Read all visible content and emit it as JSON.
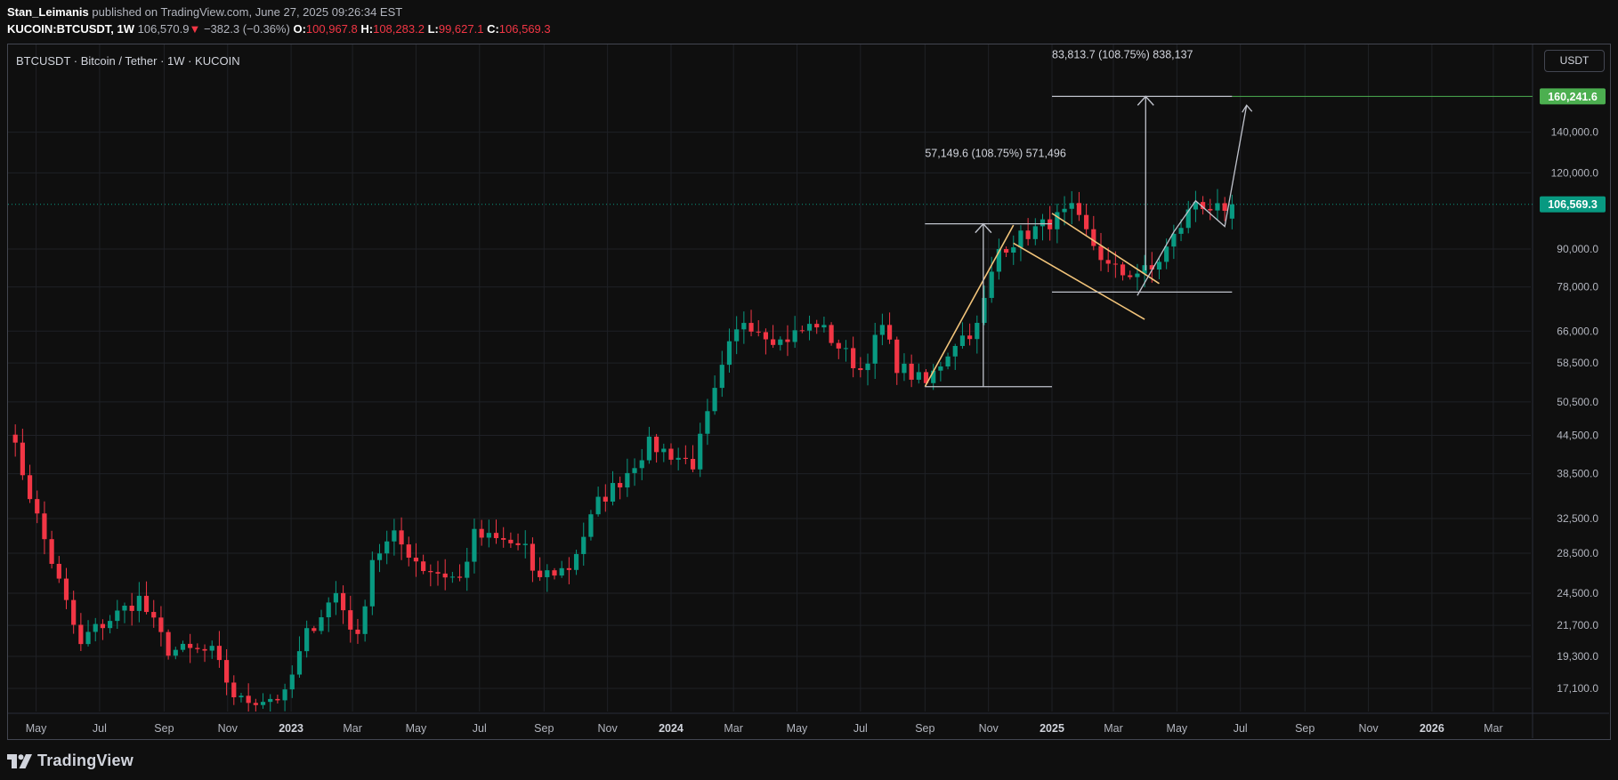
{
  "header": {
    "author": "Stan_Leimanis",
    "published": " published on TradingView.com, June 27, 2025 09:26:34 EST",
    "symbol": "KUCOIN:BTCUSDT, 1W",
    "last_price": "106,570.9",
    "change": "−382.3 (−0.36%)",
    "o_label": "O:",
    "o_value": "100,967.8",
    "h_label": "H:",
    "h_value": "108,283.2",
    "l_label": "L:",
    "l_value": "99,627.1",
    "c_label": "C:",
    "c_value": "106,569.3"
  },
  "legend": "BTCUSDT · Bitcoin / Tether · 1W · KUCOIN",
  "currency_button": "USDT",
  "footer": {
    "brand": "TradingView"
  },
  "colors": {
    "up": "#089981",
    "down": "#f23645",
    "pattern": "#f2c47a",
    "measure": "#c0c3cc",
    "target": "#4caf50",
    "background": "#0f0f0f"
  },
  "chart_data": {
    "type": "candlestick",
    "y_scale": "log",
    "ylim": [
      15000,
      200000
    ],
    "x_range": [
      "2022-04-04",
      "2026-04-06"
    ],
    "y_ticks": [
      17100,
      19300,
      21700,
      24500,
      28500,
      32500,
      38500,
      44500,
      50500,
      58500,
      66000,
      78000,
      90000,
      120000,
      140000
    ],
    "y_tick_labels": [
      "17,100.0",
      "19,300.0",
      "21,700.0",
      "24,500.0",
      "28,500.0",
      "32,500.0",
      "38,500.0",
      "44,500.0",
      "50,500.0",
      "58,500.0",
      "66,000.0",
      "78,000.0",
      "90,000.0",
      "120,000.0",
      "140,000.0"
    ],
    "x_ticks": [
      {
        "date": "2022-05-01",
        "label": "May"
      },
      {
        "date": "2022-07-01",
        "label": "Jul"
      },
      {
        "date": "2022-09-01",
        "label": "Sep"
      },
      {
        "date": "2022-11-01",
        "label": "Nov"
      },
      {
        "date": "2023-01-01",
        "label": "2023"
      },
      {
        "date": "2023-03-01",
        "label": "Mar"
      },
      {
        "date": "2023-05-01",
        "label": "May"
      },
      {
        "date": "2023-07-01",
        "label": "Jul"
      },
      {
        "date": "2023-09-01",
        "label": "Sep"
      },
      {
        "date": "2023-11-01",
        "label": "Nov"
      },
      {
        "date": "2024-01-01",
        "label": "2024"
      },
      {
        "date": "2024-03-01",
        "label": "Mar"
      },
      {
        "date": "2024-05-01",
        "label": "May"
      },
      {
        "date": "2024-07-01",
        "label": "Jul"
      },
      {
        "date": "2024-09-01",
        "label": "Sep"
      },
      {
        "date": "2024-11-01",
        "label": "Nov"
      },
      {
        "date": "2025-01-01",
        "label": "2025"
      },
      {
        "date": "2025-03-01",
        "label": "Mar"
      },
      {
        "date": "2025-05-01",
        "label": "May"
      },
      {
        "date": "2025-07-01",
        "label": "Jul"
      },
      {
        "date": "2025-09-01",
        "label": "Sep"
      },
      {
        "date": "2025-11-01",
        "label": "Nov"
      },
      {
        "date": "2026-01-01",
        "label": "2026"
      },
      {
        "date": "2026-03-01",
        "label": "Mar"
      }
    ],
    "bold_x_labels": [
      "2023",
      "2024",
      "2025",
      "2026"
    ],
    "current_price": {
      "value": 106569.3,
      "label": "106,569.3"
    },
    "target_price": {
      "value": 160241.6,
      "label": "160,241.6"
    },
    "measure_labels": [
      {
        "text": "57,149.6 (108.75%) 571,496",
        "date": "2024-09-01",
        "value": 127500
      },
      {
        "text": "83,813.7 (108.75%) 838,137",
        "date": "2025-01-01",
        "value": 185000
      }
    ],
    "pivots": [
      [
        "2022-04-04",
        46000
      ],
      [
        "2022-05-09",
        30000
      ],
      [
        "2022-06-13",
        20000
      ],
      [
        "2022-06-20",
        21000
      ],
      [
        "2022-08-08",
        24000
      ],
      [
        "2022-09-05",
        19800
      ],
      [
        "2022-10-17",
        19600
      ],
      [
        "2022-11-07",
        16700
      ],
      [
        "2022-11-14",
        16300
      ],
      [
        "2022-12-26",
        16600
      ],
      [
        "2023-01-16",
        21000
      ],
      [
        "2023-02-13",
        24500
      ],
      [
        "2023-03-06",
        20500
      ],
      [
        "2023-03-20",
        28000
      ],
      [
        "2023-04-10",
        30300
      ],
      [
        "2023-05-08",
        27000
      ],
      [
        "2023-06-12",
        25800
      ],
      [
        "2023-06-26",
        30500
      ],
      [
        "2023-08-14",
        29200
      ],
      [
        "2023-08-21",
        26000
      ],
      [
        "2023-09-25",
        27000
      ],
      [
        "2023-10-23",
        34500
      ],
      [
        "2023-11-13",
        37500
      ],
      [
        "2023-12-11",
        43000
      ],
      [
        "2024-01-22",
        40000
      ],
      [
        "2024-02-26",
        62000
      ],
      [
        "2024-03-11",
        69000
      ],
      [
        "2024-04-15",
        63500
      ],
      [
        "2024-05-20",
        68000
      ],
      [
        "2024-07-01",
        57000
      ],
      [
        "2024-07-22",
        67000
      ],
      [
        "2024-08-05",
        58000
      ],
      [
        "2024-09-02",
        54000
      ],
      [
        "2024-09-30",
        63500
      ],
      [
        "2024-10-21",
        67000
      ],
      [
        "2024-11-11",
        90000
      ],
      [
        "2024-12-16",
        97000
      ],
      [
        "2025-01-20",
        104000
      ],
      [
        "2025-02-24",
        84000
      ],
      [
        "2025-03-10",
        82000
      ],
      [
        "2025-04-07",
        83000
      ],
      [
        "2025-04-28",
        94000
      ],
      [
        "2025-05-19",
        108000
      ],
      [
        "2025-06-09",
        104000
      ],
      [
        "2025-06-16",
        101000
      ],
      [
        "2025-06-23",
        106569
      ]
    ],
    "overlays": {
      "pattern_lines": [
        [
          [
            "2024-09-01",
            53500
          ],
          [
            "2024-11-25",
            98500
          ]
        ],
        [
          [
            "2024-11-25",
            92000
          ],
          [
            "2025-03-31",
            69000
          ]
        ],
        [
          [
            "2025-01-01",
            103000
          ],
          [
            "2025-04-14",
            79000
          ]
        ]
      ],
      "measure_lines": [
        [
          [
            "2024-09-01",
            53500
          ],
          [
            "2025-01-01",
            53500
          ]
        ],
        [
          [
            "2024-09-01",
            99000
          ],
          [
            "2025-01-01",
            99000
          ]
        ],
        [
          [
            "2024-10-27",
            53500
          ],
          [
            "2024-10-27",
            99000
          ]
        ],
        [
          [
            "2025-01-01",
            76500
          ],
          [
            "2025-06-23",
            76500
          ]
        ],
        [
          [
            "2025-01-01",
            160241.6
          ],
          [
            "2025-06-23",
            160241.6
          ]
        ],
        [
          [
            "2025-04-01",
            83000
          ],
          [
            "2025-04-01",
            160241.6
          ]
        ]
      ],
      "projection_path": [
        [
          "2025-03-24",
          75500
        ],
        [
          "2025-04-28",
          96000
        ],
        [
          "2025-05-19",
          108000
        ],
        [
          "2025-06-16",
          98000
        ],
        [
          "2025-07-07",
          155000
        ]
      ]
    }
  }
}
